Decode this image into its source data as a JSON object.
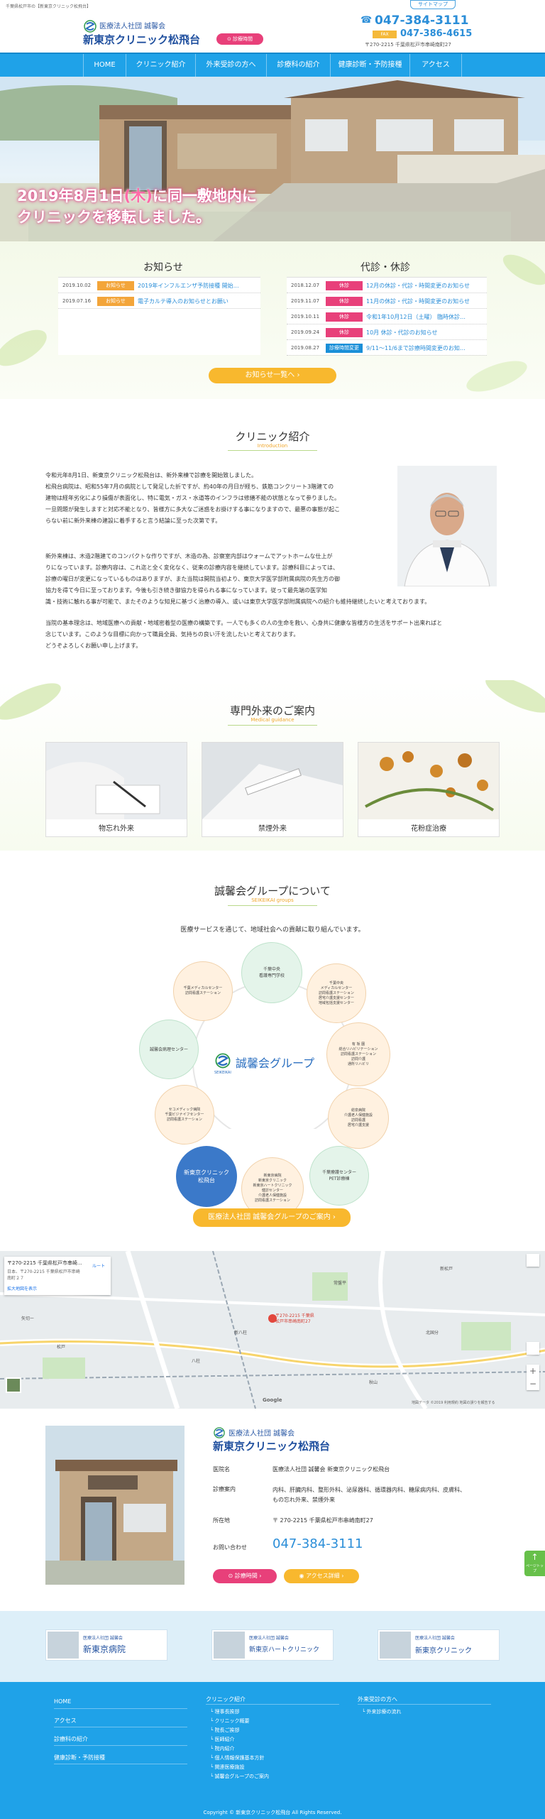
{
  "topbar": {
    "tagline": "千葉県松戸市の【新東京クリニック松飛台】",
    "sitemap": "サイトマップ"
  },
  "header": {
    "org": "医療法人社団 誠馨会",
    "clinic_name": "新東京クリニック松飛台",
    "hours_button": "診療時間",
    "tel": "047-384-3111",
    "fax_label": "FAX",
    "fax": "047-386-4615",
    "address": "〒270-2215 千葉県松戸市串崎南町27"
  },
  "nav": [
    "HOME",
    "クリニック紹介",
    "外来受診の方へ",
    "診療科の紹介",
    "健康診断・予防接種",
    "アクセス"
  ],
  "hero": {
    "line1_date": "2019年8月1日",
    "line1_day": "(木)",
    "line1_rest": "に同一敷地内に",
    "line2": "クリニックを移転",
    "line2_rest": "しました。"
  },
  "news": {
    "title": "お知らせ",
    "items": [
      {
        "date": "2019.10.02",
        "badge": "お知らせ",
        "text": "2019年インフルエンザ予防接種 開始…"
      },
      {
        "date": "2019.07.16",
        "badge": "お知らせ",
        "text": "電子カルテ導入のお知らせとお願い"
      }
    ]
  },
  "closures": {
    "title": "代診・休診",
    "items": [
      {
        "date": "2018.12.07",
        "badge": "休診",
        "text": "12月の休診・代診・時間変更のお知らせ"
      },
      {
        "date": "2019.11.07",
        "badge": "休診",
        "text": "11月の休診・代診・時間変更のお知らせ"
      },
      {
        "date": "2019.10.11",
        "badge": "休診",
        "text": "令和1年10月12日（土曜） 臨時休診…"
      },
      {
        "date": "2019.09.24",
        "badge": "休診",
        "text": "10月 休診・代診のお知らせ"
      },
      {
        "date": "2019.08.27",
        "badge": "診療時間変更",
        "text": "9/11～11/6まで診療時間変更のお知…"
      }
    ]
  },
  "news_list_button": "お知らせ一覧へ",
  "intro": {
    "title": "クリニック紹介",
    "subtitle": "Introduction",
    "p1": [
      "令和元年8月1日、新東京クリニック松飛台は、新外来棟で診療を開始致しました。",
      "松飛台病院は、昭和55年7月の病院として発足した折ですが、約40年の月日が経ち、鉄筋コンクリート3階建ての",
      "建物は経年劣化により損傷が表面化し、特に電気・ガス・水道等のインフラは修繕不能の状態となって参りました。",
      "一旦問題が発生しますと対応不能となり、皆様方に多大なご迷惑をお掛けする事になりますので、最悪の事態が起こ",
      "らない前に新外来棟の建設に着手すると言う結論に至った次第です。"
    ],
    "p2": [
      "新外来棟は、木造2階建てのコンパクトな作りですが、木造の為、診察室内部はウォームでアットホームな仕上が",
      "りになっています。診療内容は、これ迄と全く変化なく、従来の診療内容を継続しています。診療科目によっては、",
      "診療の曜日が変更になっているものはありますが、また当院は開院当初より、東京大学医学部附属病院の先生方の御",
      "協力を得て今日に至っております。今後も引き続き御協力を得られる事になっています。従って最先端の医学知",
      "識・技術に触れる事が可能で、またそのような知見に基づく治療の導入、或いは東京大学医学部附属病院への紹介も維持継続したいと考えております。"
    ],
    "p3": [
      "当院の基本理念は、地域医療への貢献・地域密着型の医療の構築です。一人でも多くの人の生命を救い、心身共に健康な皆様方の生活をサポート出来ればと",
      "念じています。このような目標に向かって職員全員、気持ちの良い汗を流したいと考えております。",
      "どうぞよろしくお願い申し上げます。"
    ]
  },
  "specialty": {
    "title": "専門外来のご案内",
    "subtitle": "Medical guidance",
    "items": [
      "物忘れ外来",
      "禁煙外来",
      "花粉症治療"
    ]
  },
  "group": {
    "title": "誠馨会グループについて",
    "subtitle": "SEIKEIKAI groups",
    "lead": "医療サービスを通じて、地域社会への貢献に取り組んでいます。",
    "logo_text": "誠馨会グループ",
    "logo_en": "SEIKEIKAI",
    "nodes": [
      {
        "name": "千葉中央\n看護専門学校",
        "color": "#e4f4ea"
      },
      {
        "name": "千葉中央\nメディカルセンター\n訪問看護ステーション\n居宅介護支援センター\n地域包括支援センター",
        "color": "#fff1e0"
      },
      {
        "name": "有 坂 園\n総合リハビリテーション\n訪問看護ステーション\n訪問介護\n通所リハビリ",
        "color": "#fff1e0"
      },
      {
        "name": "総泉病院\n介護老人保健施設\n訪問看護\n居宅介護支援",
        "color": "#fff1e0"
      },
      {
        "name": "千葉療護センター\nPET診療棟",
        "color": "#e4f4ea"
      },
      {
        "name": "新東京病院\n新東京クリニック\n新東京ハートクリニック\n健診センター\n介護老人保健施設\n訪問看護ステーション",
        "color": "#fff1e0"
      },
      {
        "name": "新東京クリニック\n松飛台",
        "color": "#3b79c9"
      },
      {
        "name": "セコメディック病院\n千葉ビジナイフセンター\n訪問看護ステーション",
        "color": "#fff1e0"
      },
      {
        "name": "誠馨会病理センター",
        "color": "#e4f4ea"
      },
      {
        "name": "千葉メディカルセンター\n訪問看護ステーション",
        "color": "#fff1e0"
      }
    ],
    "button": "医療法人社団 誠馨会グループのご案内"
  },
  "map": {
    "popup_postal": "〒270-2215 千葉県松戸市串崎...",
    "popup_addr": "日本、〒270-2215 千葉県松戸市串崎南町２７",
    "popup_route": "ルート",
    "popup_link": "拡大地図を表示",
    "marker_label": "〒270-2215 千葉県\n松戸市串崎南町27",
    "google": "Google",
    "credit": "地図データ ©2019 利用規約 地図の誤りを報告する",
    "places": [
      "矢切ー",
      "松戸",
      "八柱",
      "常盤平",
      "新松戸",
      "北国分",
      "秋山",
      "新八柱"
    ]
  },
  "clinic_info": {
    "org": "医療法人社団 誠馨会",
    "name": "新東京クリニック松飛台",
    "rows": [
      {
        "label": "医院名",
        "value": "医療法人社団 誠馨会 新東京クリニック松飛台"
      },
      {
        "label": "診療案内",
        "value": "内科、肝臓内科、整形外科、泌尿器科、循環器内科、糖尿病内科、皮膚科、\nもの忘れ外来、禁煙外来"
      },
      {
        "label": "所在地",
        "value": "〒 270-2215 千葉県松戸市串崎南町27"
      },
      {
        "label": "お問い合わせ",
        "value": "047-384-3111"
      }
    ],
    "hours_button": "診療時間",
    "access_button": "アクセス詳細"
  },
  "related": [
    {
      "org": "医療法人社団 誠馨会",
      "name": "新東京病院"
    },
    {
      "org": "医療法人社団 誠馨会",
      "name": "新東京ハートクリニック"
    },
    {
      "org": "医療法人社団 誠馨会",
      "name": "新東京クリニック"
    }
  ],
  "pagetop": "ページトップ",
  "footer": {
    "col1": [
      "HOME",
      "アクセス",
      "診療科の紹介",
      "健康診断・予防接種"
    ],
    "col2_title": "クリニック紹介",
    "col2": [
      "理事長挨拶",
      "クリニック概要",
      "院長ご挨拶",
      "医師紹介",
      "院内紹介",
      "個人情報保護基本方針",
      "関連医療施設",
      "誠馨会グループのご案内"
    ],
    "col3_title": "外来受診の方へ",
    "col3": [
      "外来診療の流れ"
    ],
    "copyright": "Copyright © 新東京クリニック松飛台 All Rights Reserved."
  }
}
